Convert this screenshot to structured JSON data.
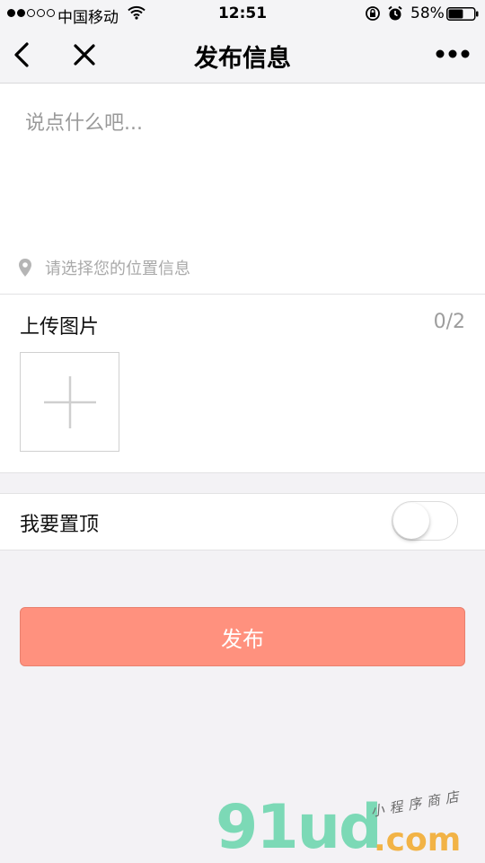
{
  "status_bar": {
    "carrier": "中国移动",
    "time": "12:51",
    "battery_percent": "58%",
    "battery_level": 0.58,
    "signal_bars_filled": 2,
    "signal_bars_total": 5,
    "icons": [
      "wifi-icon",
      "rotation-lock-icon",
      "alarm-icon",
      "battery-icon"
    ]
  },
  "nav": {
    "title": "发布信息",
    "back_icon": "chevron-left-icon",
    "close_icon": "close-icon",
    "more_icon": "more-dots-icon"
  },
  "post": {
    "placeholder": "说点什么吧...",
    "location_icon": "location-pin-icon",
    "location_label": "请选择您的位置信息"
  },
  "upload": {
    "title": "上传图片",
    "count": "0/2",
    "add_icon": "plus-icon"
  },
  "sticky": {
    "label": "我要置顶",
    "enabled": false
  },
  "publish": {
    "label": "发布"
  },
  "watermark": {
    "main": "91ud",
    "suffix": ".com",
    "tag": "小程序商店"
  },
  "colors": {
    "background": "#f3f2f5",
    "publish_button": "#ff917e",
    "placeholder_text": "#9a9a9a",
    "watermark_green": "#7cd9b6",
    "watermark_orange": "#f2b346"
  }
}
